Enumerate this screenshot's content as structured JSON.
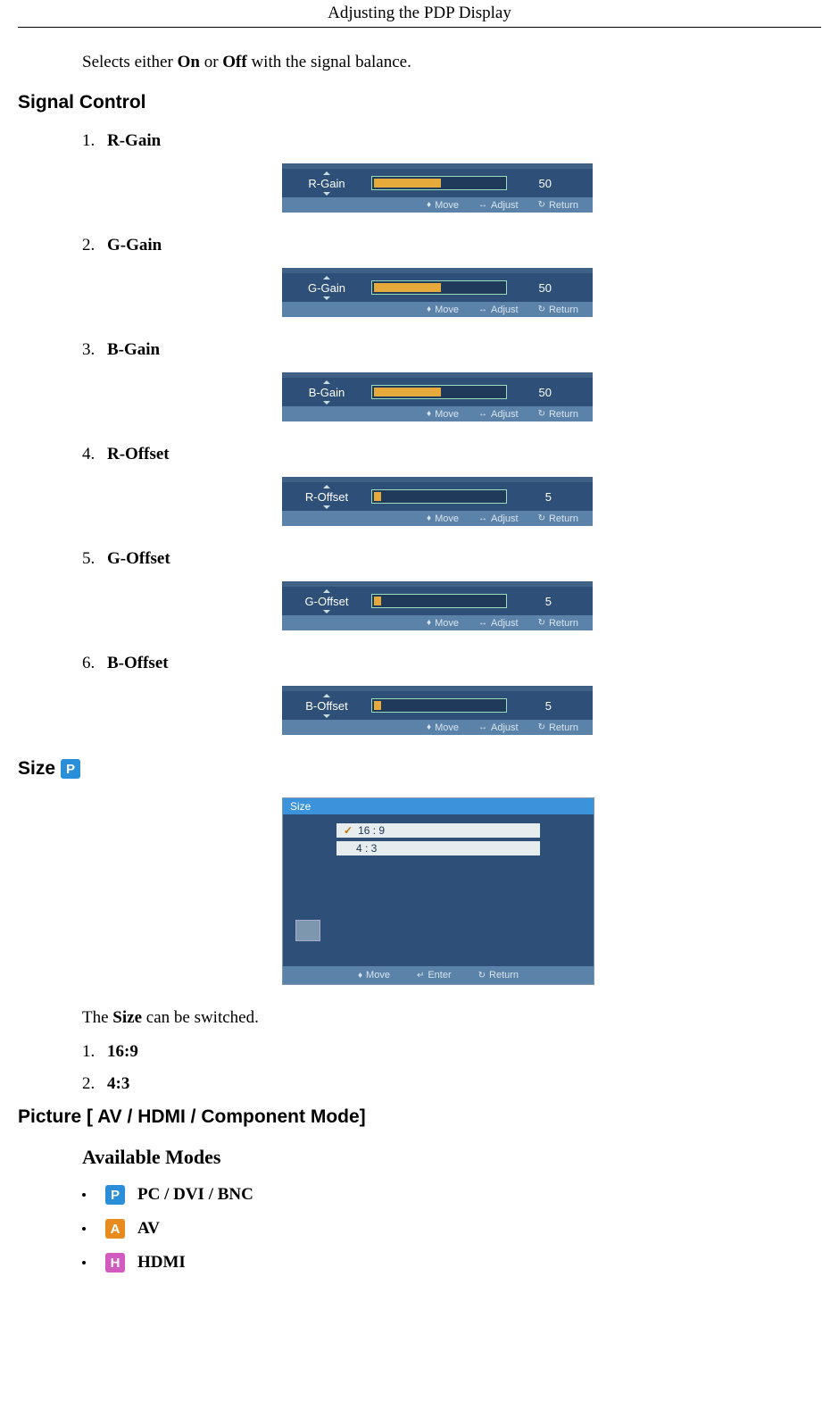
{
  "header": {
    "title": "Adjusting the PDP Display"
  },
  "intro": {
    "prefix": "Selects either ",
    "on": "On",
    "mid": " or ",
    "off": "Off",
    "suffix": " with the signal balance."
  },
  "signal_control": {
    "heading": "Signal Control",
    "items": [
      {
        "num": "1.",
        "name": "R-Gain",
        "value": "50",
        "pct": 50
      },
      {
        "num": "2.",
        "name": "G-Gain",
        "value": "50",
        "pct": 50
      },
      {
        "num": "3.",
        "name": "B-Gain",
        "value": "50",
        "pct": 50
      },
      {
        "num": "4.",
        "name": "R-Offset",
        "value": "5",
        "pct": 5
      },
      {
        "num": "5.",
        "name": "G-Offset",
        "value": "5",
        "pct": 5
      },
      {
        "num": "6.",
        "name": "B-Offset",
        "value": "5",
        "pct": 5
      }
    ],
    "footer": {
      "move": "Move",
      "adjust": "Adjust",
      "return": "Return"
    }
  },
  "size": {
    "heading": "Size",
    "icon_letter": "P",
    "panel_title": "Size",
    "options": [
      {
        "label": "16 : 9",
        "selected": true
      },
      {
        "label": "4 : 3",
        "selected": false
      }
    ],
    "footer": {
      "move": "Move",
      "enter": "Enter",
      "return": "Return"
    },
    "sentence_pre": "The ",
    "sentence_bold": "Size",
    "sentence_post": " can be switched.",
    "list": [
      {
        "num": "1.",
        "label": "16:9"
      },
      {
        "num": "2.",
        "label": "4:3"
      }
    ]
  },
  "picture": {
    "heading": "Picture [ AV / HDMI / Component Mode]",
    "sub": "Available Modes",
    "modes": [
      {
        "letter": "P",
        "cls": "ic-p",
        "label": "PC / DVI / BNC"
      },
      {
        "letter": "A",
        "cls": "ic-a",
        "label": "AV"
      },
      {
        "letter": "H",
        "cls": "ic-h",
        "label": "HDMI"
      }
    ]
  }
}
